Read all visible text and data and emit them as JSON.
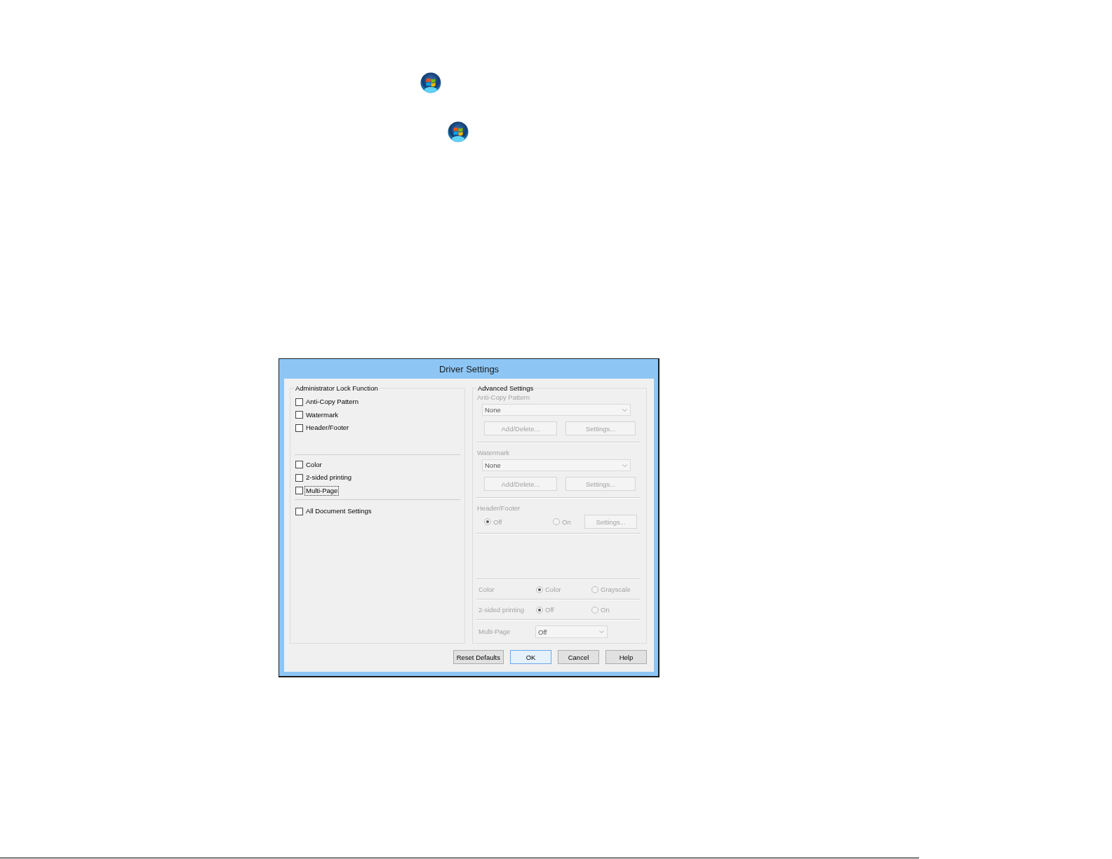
{
  "dialog": {
    "title": "Driver Settings",
    "lock_group": {
      "title": "Administrator Lock Function",
      "sections": [
        {
          "items": [
            {
              "label": "Anti-Copy Pattern",
              "checked": false,
              "focused": false
            },
            {
              "label": "Watermark",
              "checked": false,
              "focused": false
            },
            {
              "label": "Header/Footer",
              "checked": false,
              "focused": false
            }
          ]
        },
        {
          "items": [
            {
              "label": "Color",
              "checked": false,
              "focused": false
            },
            {
              "label": "2-sided printing",
              "checked": false,
              "focused": false
            },
            {
              "label": "Multi-Page",
              "checked": false,
              "focused": true
            }
          ]
        },
        {
          "items": [
            {
              "label": "All Document Settings",
              "checked": false,
              "focused": false
            }
          ]
        }
      ]
    },
    "advanced_group": {
      "title": "Advanced Settings",
      "disabled": true,
      "blocks": [
        {
          "kind": "select",
          "label": "Anti-Copy Pattern",
          "value": "None",
          "buttons": [
            "Add/Delete...",
            "Settings..."
          ]
        },
        {
          "kind": "select",
          "label": "Watermark",
          "value": "None",
          "buttons": [
            "Add/Delete...",
            "Settings..."
          ]
        },
        {
          "kind": "radio",
          "label": "Header/Footer",
          "options": [
            {
              "label": "Off",
              "selected": true
            },
            {
              "label": "On",
              "selected": false
            }
          ],
          "button": "Settings..."
        }
      ],
      "rows": [
        {
          "kind": "radio",
          "label": "Color",
          "options": [
            {
              "label": "Color",
              "selected": true
            },
            {
              "label": "Grayscale",
              "selected": false
            }
          ]
        },
        {
          "kind": "radio",
          "label": "2-sided printing",
          "options": [
            {
              "label": "Off",
              "selected": true
            },
            {
              "label": "On",
              "selected": false
            }
          ]
        },
        {
          "kind": "select",
          "label": "Multi-Page",
          "value": "Off"
        }
      ]
    },
    "buttons": [
      {
        "label": "Reset Defaults",
        "default": false
      },
      {
        "label": "OK",
        "default": true
      },
      {
        "label": "Cancel",
        "default": false
      },
      {
        "label": "Help",
        "default": false
      }
    ]
  }
}
